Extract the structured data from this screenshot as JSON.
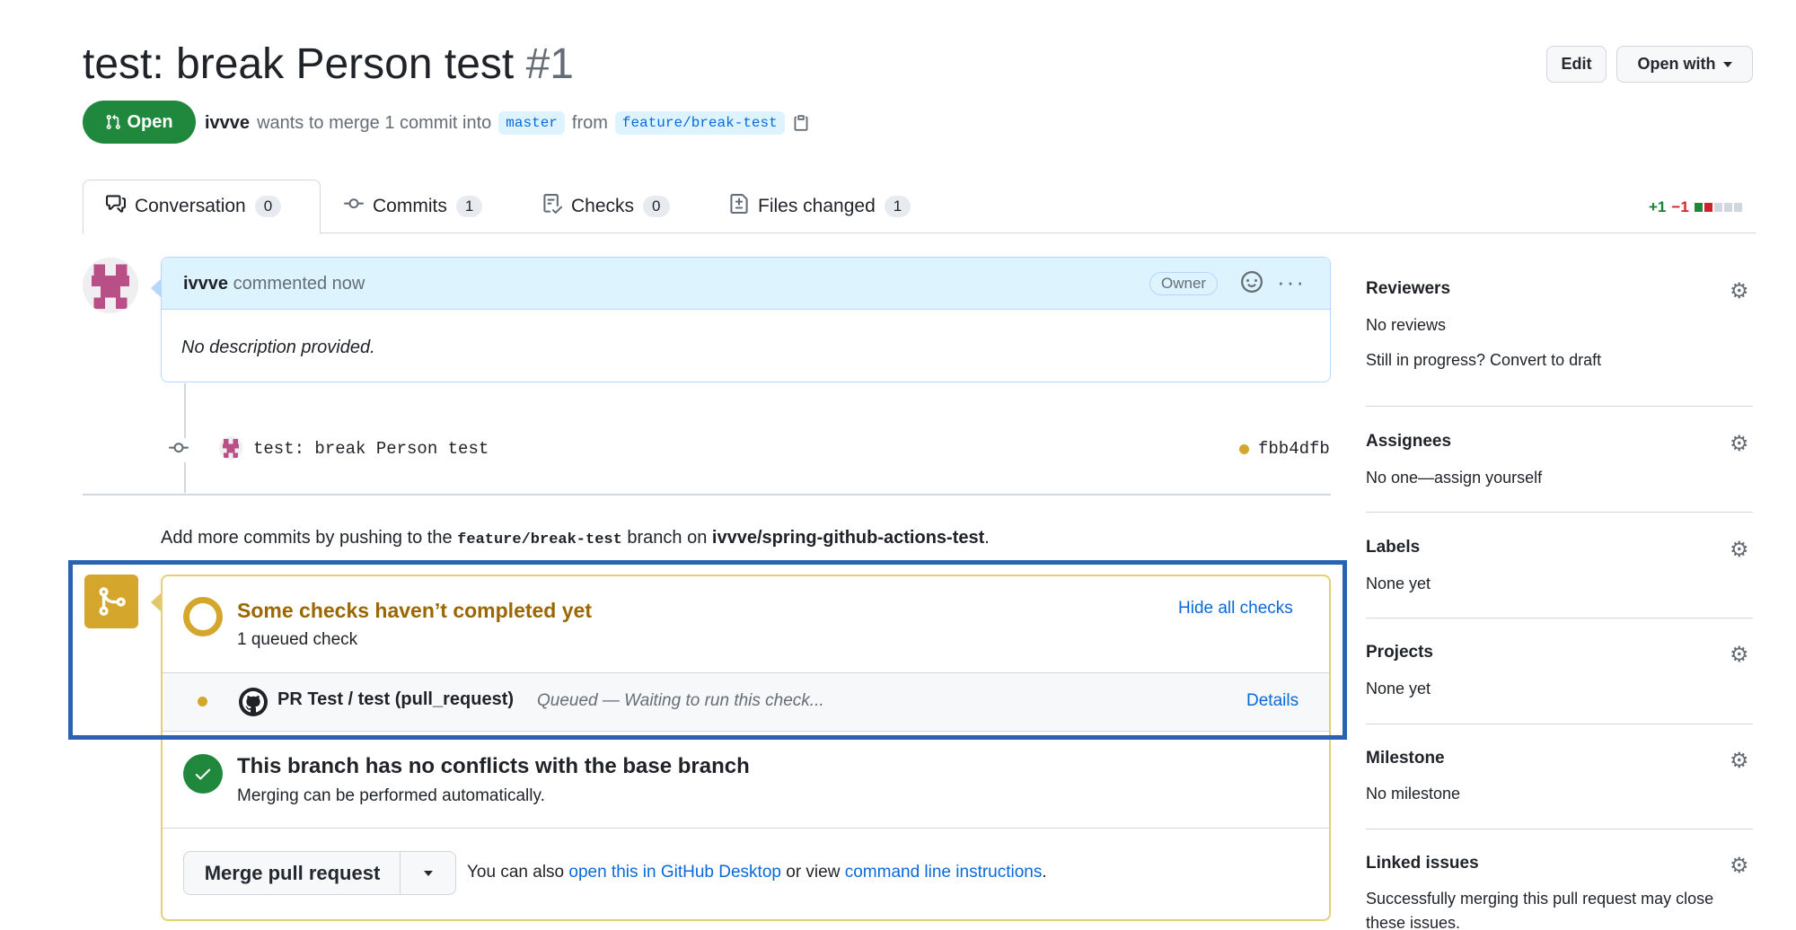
{
  "header": {
    "title": "test: break Person test",
    "number": "#1",
    "edit_label": "Edit",
    "open_with_label": "Open with"
  },
  "state": {
    "label": "Open",
    "author": "ivvve",
    "merge_text": "wants to merge 1 commit into",
    "base_branch": "master",
    "from_text": "from",
    "head_branch": "feature/break-test"
  },
  "tabs": [
    {
      "label": "Conversation",
      "count": "0",
      "icon": "comment-discussion-icon"
    },
    {
      "label": "Commits",
      "count": "1",
      "icon": "git-commit-icon"
    },
    {
      "label": "Checks",
      "count": "0",
      "icon": "checklist-icon"
    },
    {
      "label": "Files changed",
      "count": "1",
      "icon": "file-diff-icon"
    }
  ],
  "diffstat": {
    "additions": "+1",
    "deletions": "−1"
  },
  "comment": {
    "author": "ivvve",
    "time": "commented now",
    "role": "Owner",
    "body": "No description provided."
  },
  "commit": {
    "message": "test: break Person test",
    "sha": "fbb4dfb"
  },
  "push_hint": {
    "prefix": "Add more commits by pushing to the",
    "branch": "feature/break-test",
    "middle": "branch on",
    "repo": "ivvve/spring-github-actions-test",
    "suffix": "."
  },
  "checks": {
    "title": "Some checks haven’t completed yet",
    "subtitle": "1 queued check",
    "hide_label": "Hide all checks",
    "items": [
      {
        "name": "PR Test / test (pull_request)",
        "status": "Queued — Waiting to run this check...",
        "details_label": "Details"
      }
    ]
  },
  "conflicts": {
    "title": "This branch has no conflicts with the base branch",
    "subtitle": "Merging can be performed automatically."
  },
  "merge": {
    "button_label": "Merge pull request",
    "alt_prefix": "You can also",
    "desktop_link": "open this in GitHub Desktop",
    "alt_middle": "or view",
    "cli_link": "command line instructions",
    "alt_suffix": "."
  },
  "sidebar": {
    "reviewers": {
      "title": "Reviewers",
      "line1": "No reviews",
      "line2": "Still in progress? Convert to draft"
    },
    "assignees": {
      "title": "Assignees",
      "line1": "No one—assign yourself"
    },
    "labels": {
      "title": "Labels",
      "line1": "None yet"
    },
    "projects": {
      "title": "Projects",
      "line1": "None yet"
    },
    "milestone": {
      "title": "Milestone",
      "line1": "No milestone"
    },
    "linked_issues": {
      "title": "Linked issues",
      "line1": "Successfully merging this pull request may close",
      "line2": "these issues."
    }
  },
  "colors": {
    "open_green": "#1f883d",
    "pending_yellow": "#d4a72c",
    "link_blue": "#0969da",
    "highlight_blue": "#2b63b2"
  }
}
